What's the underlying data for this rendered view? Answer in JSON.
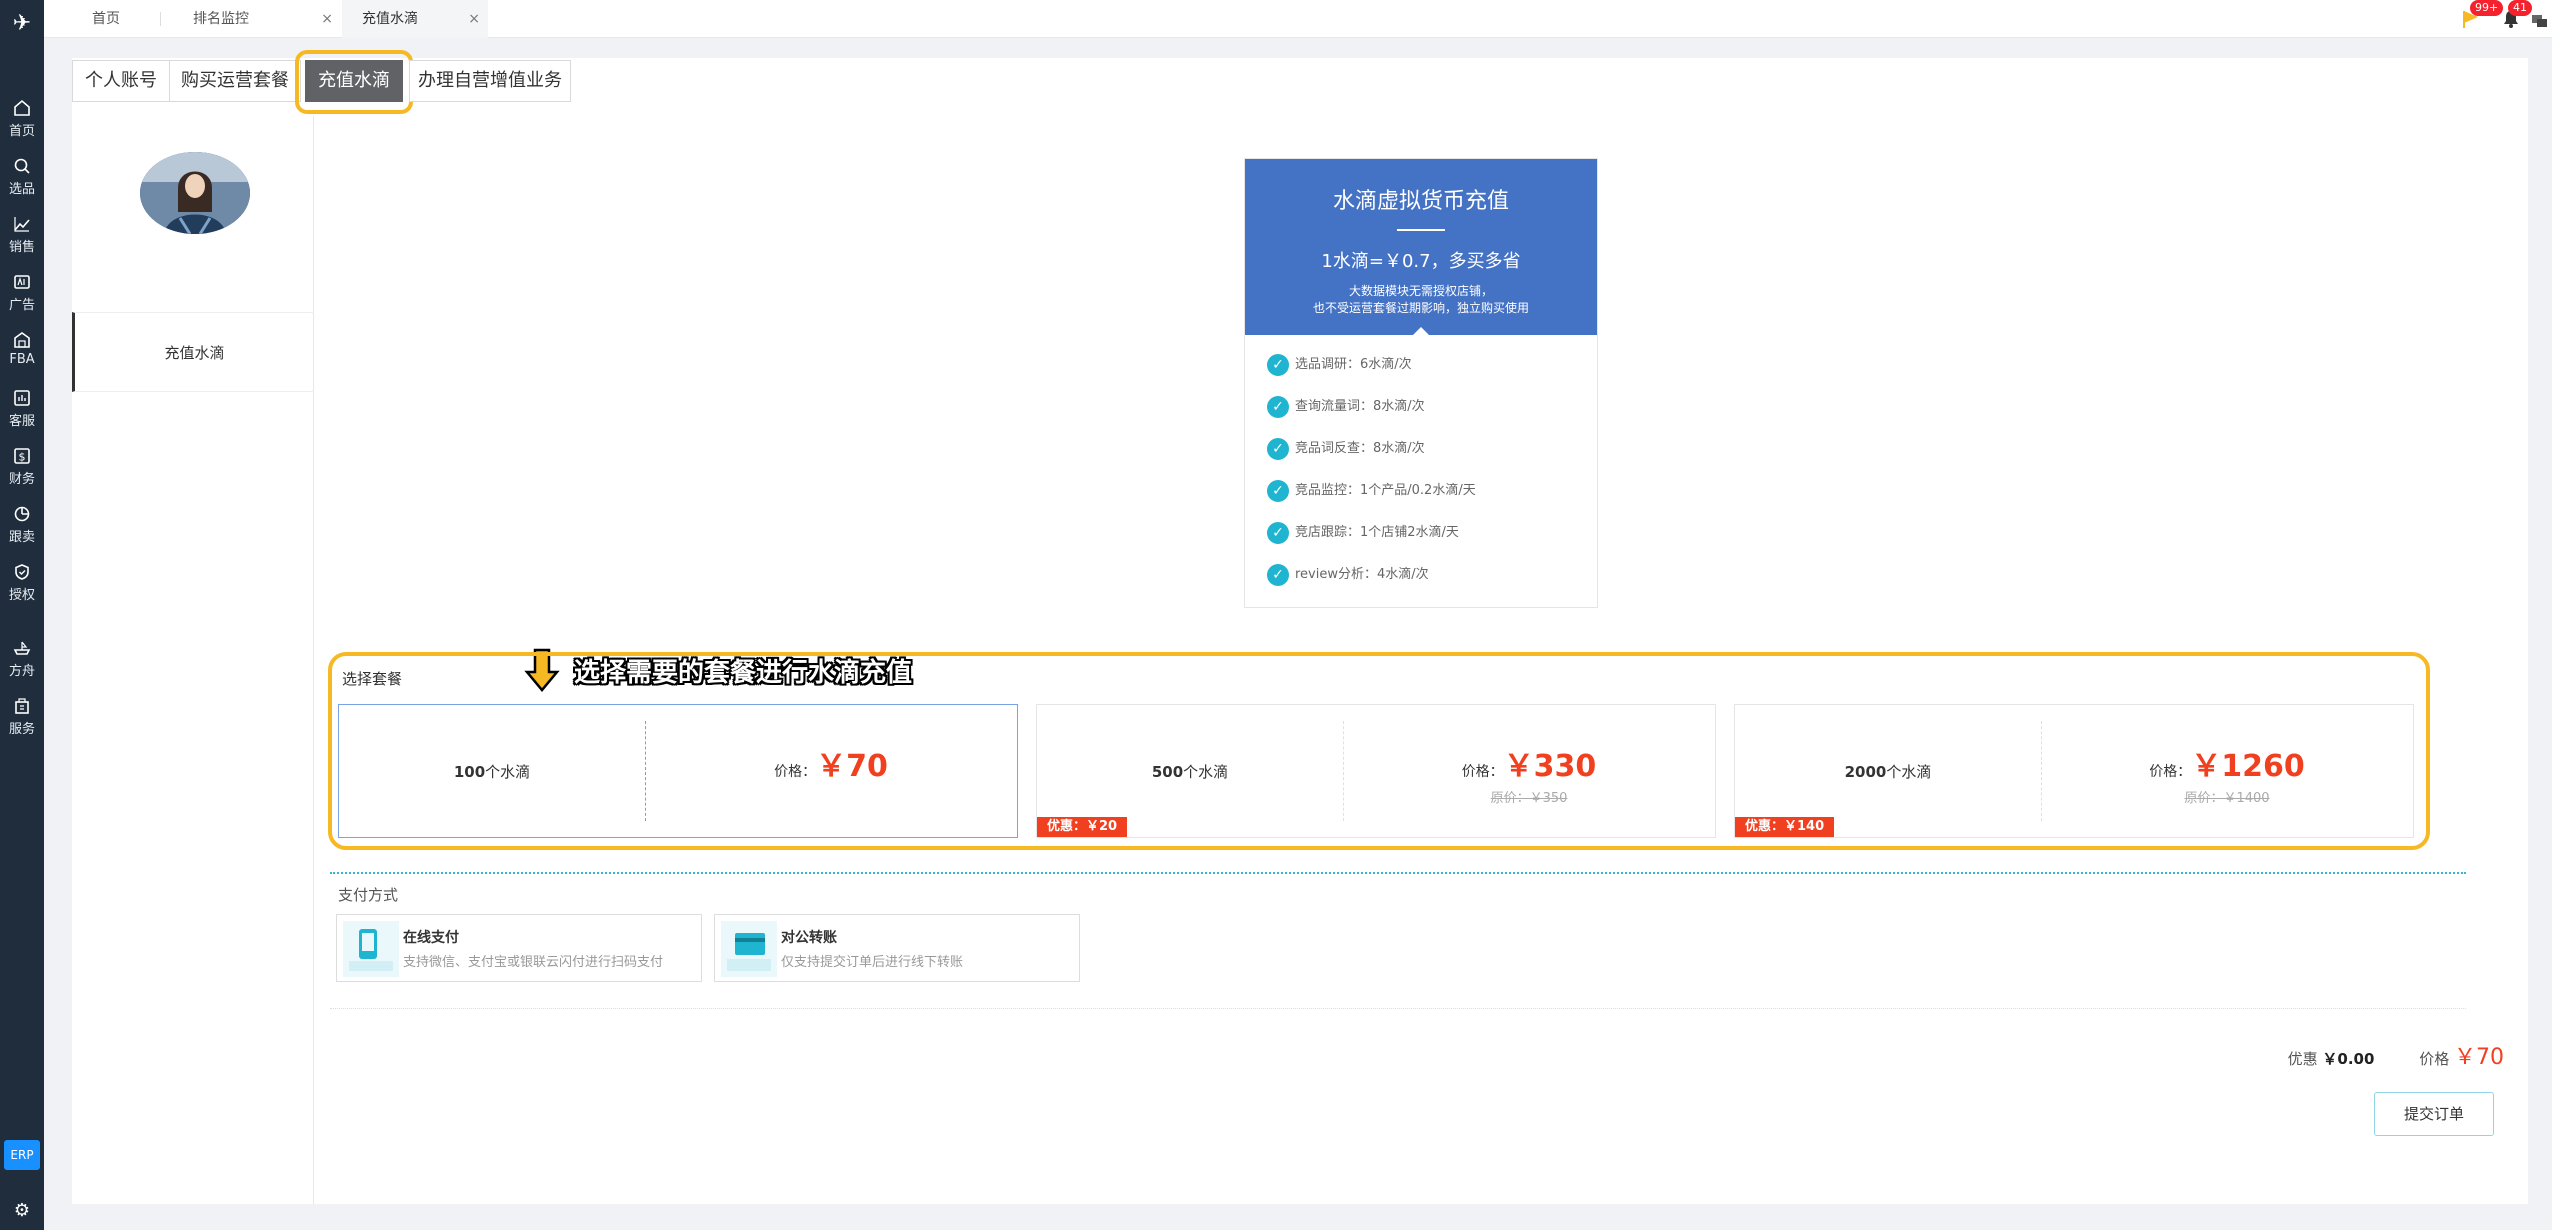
{
  "sidebar": {
    "items": [
      {
        "label": "首页",
        "icon": "home-icon"
      },
      {
        "label": "选品",
        "icon": "search-icon"
      },
      {
        "label": "销售",
        "icon": "chart-icon"
      },
      {
        "label": "广告",
        "icon": "ad-icon"
      },
      {
        "label": "FBA",
        "icon": "fba-icon"
      },
      {
        "label": "客服",
        "icon": "service-icon"
      },
      {
        "label": "财务",
        "icon": "finance-icon"
      },
      {
        "label": "跟卖",
        "icon": "pie-icon"
      },
      {
        "label": "授权",
        "icon": "shield-icon"
      },
      {
        "label": "方舟",
        "icon": "ark-icon"
      },
      {
        "label": "服务",
        "icon": "building-icon"
      }
    ],
    "erp": "ERP"
  },
  "top_tabs": [
    {
      "label": "首页",
      "closable": false
    },
    {
      "label": "排名监控",
      "closable": true
    },
    {
      "label": "充值水滴",
      "closable": true,
      "active": true
    }
  ],
  "top_icons": {
    "flag_badge": "99+",
    "bell_badge": "41"
  },
  "sub_tabs": [
    "个人账号",
    "购买运营套餐",
    "充值水滴",
    "办理自营增值业务"
  ],
  "left_panel": {
    "item": "充值水滴"
  },
  "info_card": {
    "title": "水滴虚拟货币充值",
    "rate": "1水滴=￥0.7，多买多省",
    "note_line1": "大数据模块无需授权店铺，",
    "note_line2": "也不受运营套餐过期影响，独立购买使用",
    "rows": [
      "选品调研：6水滴/次",
      "查询流量词：8水滴/次",
      "竞品词反查：8水滴/次",
      "竞品监控：1个产品/0.2水滴/天",
      "竞店跟踪：1个店铺2水滴/天",
      "review分析：4水滴/次"
    ]
  },
  "annotation": "选择需要的套餐进行水滴充值",
  "packages": {
    "label": "选择套餐",
    "price_label": "价格：",
    "unit": "个水滴",
    "items": [
      {
        "qty": "100",
        "price": "￥70",
        "original": "",
        "discount": ""
      },
      {
        "qty": "500",
        "price": "￥330",
        "original": "原价：￥350",
        "discount": "优惠：￥20"
      },
      {
        "qty": "2000",
        "price": "￥1260",
        "original": "原价：￥1400",
        "discount": "优惠：￥140"
      }
    ]
  },
  "payment": {
    "label": "支付方式",
    "online_title": "在线支付",
    "online_desc": "支持微信、支付宝或银联云闪付进行扫码支付",
    "transfer_title": "对公转账",
    "transfer_desc": "仅支持提交订单后进行线下转账"
  },
  "summary": {
    "discount_label": "优惠",
    "discount_value": "￥0.00",
    "price_label": "价格",
    "price_value": "￥70"
  },
  "submit_label": "提交订单",
  "colors": {
    "accent_blue": "#4472c4",
    "highlight": "#f6b924",
    "price_red": "#f1401f",
    "check": "#1fb4cf"
  }
}
